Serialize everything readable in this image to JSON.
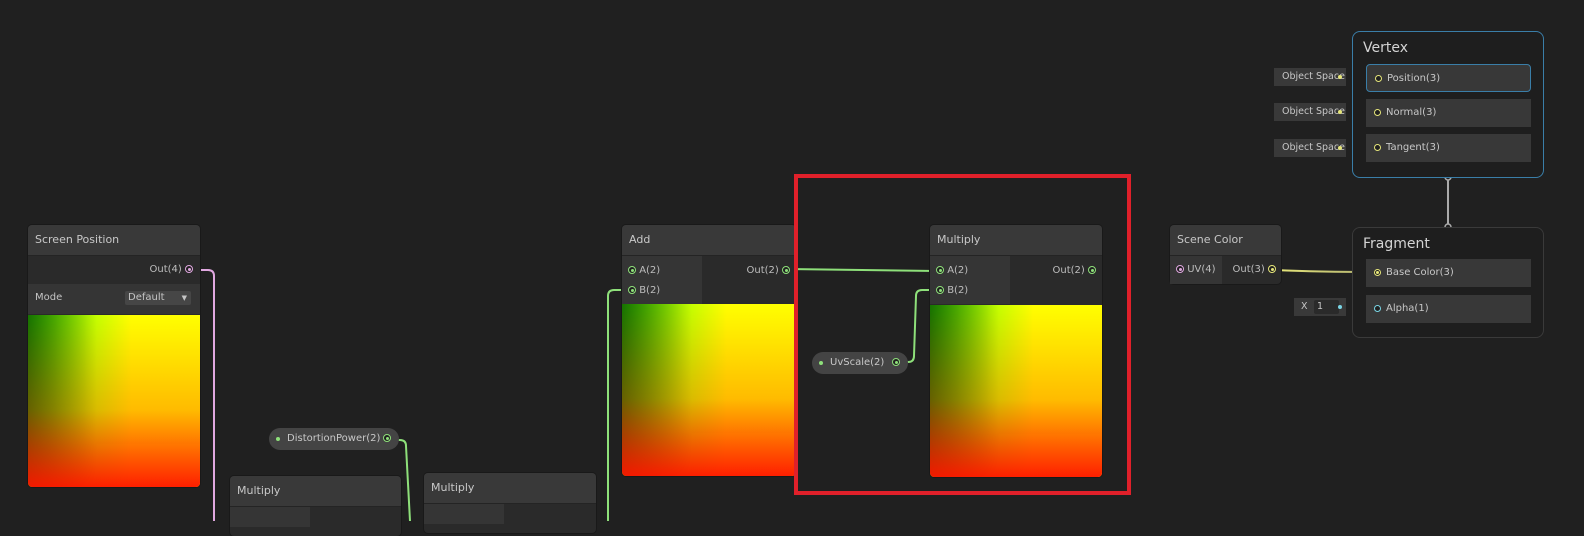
{
  "nodes": {
    "screen_position": {
      "title": "Screen Position",
      "out": "Out(4)",
      "mode_label": "Mode",
      "mode_value": "Default"
    },
    "add": {
      "title": "Add",
      "in_a": "A(2)",
      "in_b": "B(2)",
      "out": "Out(2)"
    },
    "multiply_main": {
      "title": "Multiply",
      "in_a": "A(2)",
      "in_b": "B(2)",
      "out": "Out(2)"
    },
    "scene_color": {
      "title": "Scene Color",
      "in_uv": "UV(4)",
      "out": "Out(3)"
    },
    "multiply_bottom_left": {
      "title": "Multiply"
    },
    "multiply_bottom": {
      "title": "Multiply"
    }
  },
  "properties": {
    "uv_scale": "UvScale(2)",
    "distortion_power": "DistortionPower(2)"
  },
  "vertex": {
    "title": "Vertex",
    "slots": [
      {
        "label": "Position(3)",
        "input": "Object Space"
      },
      {
        "label": "Normal(3)",
        "input": "Object Space"
      },
      {
        "label": "Tangent(3)",
        "input": "Object Space"
      }
    ]
  },
  "fragment": {
    "title": "Fragment",
    "slots": [
      {
        "label": "Base Color(3)"
      },
      {
        "label": "Alpha(1)",
        "input_axis": "X",
        "input_value": "1"
      }
    ]
  },
  "colors": {
    "highlight": "#e0202a",
    "vector2": "#8ee07a",
    "vector4": "#e0a8e0",
    "vector3": "#e6e67a",
    "float": "#7ad6e6"
  }
}
